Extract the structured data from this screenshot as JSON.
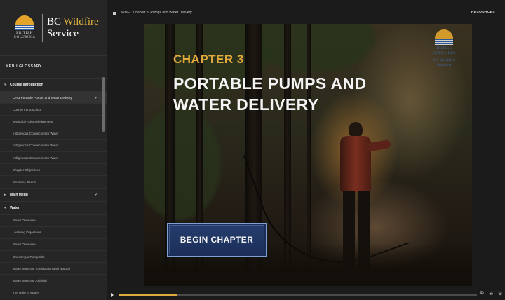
{
  "brand": {
    "crest_line1": "BRITISH",
    "crest_line2": "COLUMBIA",
    "name_line1_a": "BC ",
    "name_line1_b": "Wildfire",
    "name_line2": "Service"
  },
  "sidebar": {
    "menu_label": "MENU  GLOSSARY",
    "sections": [
      {
        "label": "Course Introduction",
        "expanded": true,
        "items": [
          {
            "label": "CH 3 Portable Pumps and Water Delivery",
            "completed": true,
            "current": true
          },
          {
            "label": "Course Introduction",
            "completed": false
          },
          {
            "label": "Territorial Acknowledgement",
            "completed": false
          },
          {
            "label": "Indigenous Connection to Water",
            "completed": false
          },
          {
            "label": "Indigenous Connection to Water",
            "completed": false
          },
          {
            "label": "Indigenous Connection to Water",
            "completed": false
          },
          {
            "label": "Chapter Objectives",
            "completed": false
          },
          {
            "label": "Welcome Scene",
            "completed": false
          }
        ]
      },
      {
        "label": "Main Menu",
        "expanded": false,
        "completed": true
      },
      {
        "label": "Water",
        "expanded": true,
        "items": [
          {
            "label": "Water Overview"
          },
          {
            "label": "Learning Objectives"
          },
          {
            "label": "Water Overview"
          },
          {
            "label": "Choosing a Pump Site"
          },
          {
            "label": "Water Sources: Introduction and Natural"
          },
          {
            "label": "Water Sources: Artificial"
          },
          {
            "label": "The Role of Water"
          }
        ]
      }
    ]
  },
  "topbar": {
    "title": "WDEC Chapter 3: Pumps and Water Delivery",
    "resources": "RESOURCES"
  },
  "slide": {
    "chapter_label": "CHAPTER 3",
    "title": "PORTABLE PUMPS AND WATER DELIVERY",
    "logo_line1": "BRITISH",
    "logo_line2": "COLUMBIA",
    "logo_line3": "BC Wildfire",
    "logo_line4": "Service",
    "begin_button": "BEGIN CHAPTER"
  },
  "player": {
    "progress_fraction": 0.16,
    "accent_color": "#e0a93c"
  },
  "icons": [
    "menu-icon",
    "play-icon",
    "captions-icon",
    "volume-icon",
    "settings-icon",
    "check-icon",
    "caret-down-icon"
  ]
}
